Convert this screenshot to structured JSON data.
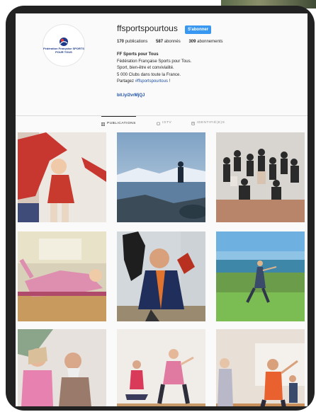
{
  "profile": {
    "username": "ffsportspourtous",
    "follow_label": "S'abonner",
    "stats": [
      {
        "num": "170",
        "label": "publications"
      },
      {
        "num": "587",
        "label": "abonnés"
      },
      {
        "num": "309",
        "label": "abonnements"
      }
    ],
    "bio": {
      "name": "FF Sports pour Tous",
      "line1": "Fédération Française Sports pour Tous.",
      "line2": "Sport, bien-être et convivialité.",
      "line3": "5 000 Clubs dans toute la France.",
      "line4_prefix": "Partagez ",
      "hashtag": "#ffsportspourtous",
      "line4_suffix": " !",
      "link": "bit.ly/2vrMjQJ"
    },
    "avatar_text": "Fédération Française SPORTS POUR TOUS"
  },
  "tabs": [
    {
      "label": "PUBLICATIONS",
      "icon": "grid-icon"
    },
    {
      "label": "IGTV",
      "icon": "tv-icon"
    },
    {
      "label": "IDENTIFIÉ(E)S",
      "icon": "tag-icon"
    }
  ],
  "colors": {
    "accent": "#3897f0",
    "link": "#1e4fa3"
  }
}
